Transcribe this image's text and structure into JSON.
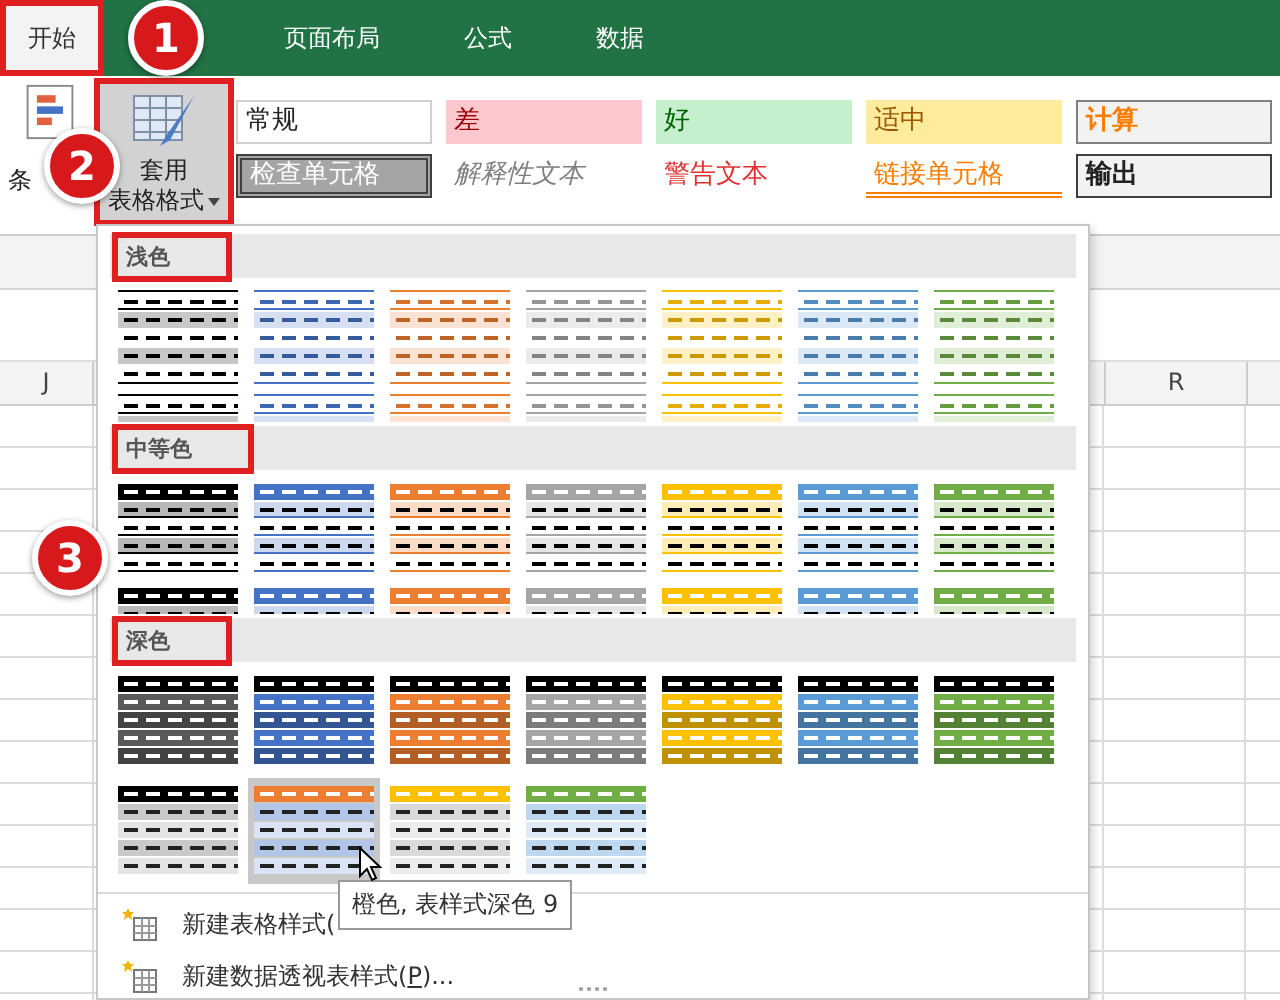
{
  "tabs": [
    {
      "label": "开始",
      "selected": true,
      "highlighted": true
    },
    {
      "label": "页面布局",
      "selected": false,
      "highlighted": false
    },
    {
      "label": "公式",
      "selected": false,
      "highlighted": false
    },
    {
      "label": "数据",
      "selected": false,
      "highlighted": false
    }
  ],
  "ribbon": {
    "conditional_button": {
      "label": "条"
    },
    "table_format_button": {
      "line1": "套用",
      "line2": "表格格式",
      "selected": true,
      "highlighted": true
    },
    "cell_styles": [
      {
        "label": "常规",
        "kind": "normal"
      },
      {
        "label": "差",
        "kind": "bad"
      },
      {
        "label": "好",
        "kind": "good"
      },
      {
        "label": "适中",
        "kind": "neutral"
      },
      {
        "label": "计算",
        "kind": "calculation"
      },
      {
        "label": "检查单元格",
        "kind": "check"
      },
      {
        "label": "解释性文本",
        "kind": "explanatory"
      },
      {
        "label": "警告文本",
        "kind": "warning"
      },
      {
        "label": "链接单元格",
        "kind": "linked"
      },
      {
        "label": "输出",
        "kind": "output"
      }
    ]
  },
  "sheet": {
    "column_headers": [
      "J",
      "R"
    ]
  },
  "gallery": {
    "sections": [
      {
        "title": "浅色",
        "highlighted": true,
        "kind": "light",
        "thumbnails": [
          {
            "color": "#000000",
            "selected": false
          },
          {
            "color": "#4472c4",
            "selected": false
          },
          {
            "color": "#ed7d31",
            "selected": false
          },
          {
            "color": "#a5a5a5",
            "selected": false
          },
          {
            "color": "#ffc000",
            "selected": false
          },
          {
            "color": "#5b9bd5",
            "selected": false
          },
          {
            "color": "#70ad47",
            "selected": false
          },
          {
            "color": "#000000",
            "selected": false
          },
          {
            "color": "#4472c4",
            "selected": false
          },
          {
            "color": "#ed7d31",
            "selected": false
          },
          {
            "color": "#a5a5a5",
            "selected": false
          },
          {
            "color": "#ffc000",
            "selected": false
          },
          {
            "color": "#5b9bd5",
            "selected": false
          },
          {
            "color": "#70ad47",
            "selected": false
          }
        ]
      },
      {
        "title": "中等色",
        "highlighted": true,
        "kind": "medium",
        "thumbnails": [
          {
            "color": "#000000",
            "selected": false
          },
          {
            "color": "#4472c4",
            "selected": false
          },
          {
            "color": "#ed7d31",
            "selected": false
          },
          {
            "color": "#a5a5a5",
            "selected": false
          },
          {
            "color": "#ffc000",
            "selected": false
          },
          {
            "color": "#5b9bd5",
            "selected": false
          },
          {
            "color": "#70ad47",
            "selected": false
          },
          {
            "color": "#000000",
            "selected": false
          },
          {
            "color": "#4472c4",
            "selected": false
          },
          {
            "color": "#ed7d31",
            "selected": false
          },
          {
            "color": "#a5a5a5",
            "selected": false
          },
          {
            "color": "#ffc000",
            "selected": false
          },
          {
            "color": "#5b9bd5",
            "selected": false
          },
          {
            "color": "#70ad47",
            "selected": false
          }
        ]
      },
      {
        "title": "深色",
        "highlighted": true,
        "kind": "dark",
        "thumbnails": [
          {
            "color": "#595959",
            "selected": false
          },
          {
            "color": "#4472c4",
            "selected": false
          },
          {
            "color": "#ed7d31",
            "selected": false
          },
          {
            "color": "#a5a5a5",
            "selected": false
          },
          {
            "color": "#ffc000",
            "selected": false
          },
          {
            "color": "#5b9bd5",
            "selected": false
          },
          {
            "color": "#70ad47",
            "selected": false
          },
          {
            "color": "#000000",
            "kind": "banded",
            "selected": false
          },
          {
            "color": "#ed7d31",
            "kind": "banded",
            "selected": true
          },
          {
            "color": "#ffc000",
            "kind": "banded",
            "selected": false
          },
          {
            "color": "#70ad47",
            "kind": "banded",
            "selected": false
          }
        ]
      }
    ],
    "menu_items": [
      {
        "label": "新建表格样式("
      },
      {
        "label": "新建数据透视表样式(**P**)..."
      }
    ],
    "tooltip": "橙色, 表样式深色 9"
  },
  "annotations": [
    "1",
    "2",
    "3"
  ]
}
